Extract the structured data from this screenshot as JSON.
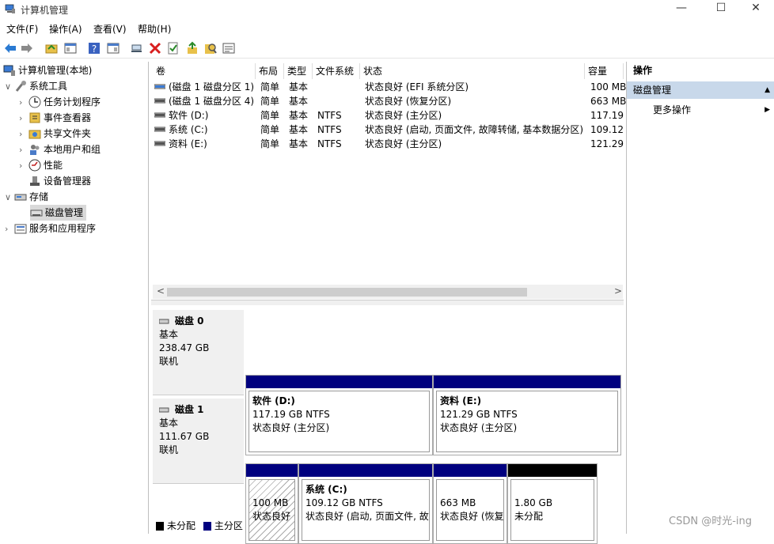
{
  "window": {
    "title": "计算机管理",
    "minimize": "—",
    "maximize": "☐",
    "close": "✕"
  },
  "menu": [
    "文件(F)",
    "操作(A)",
    "查看(V)",
    "帮助(H)"
  ],
  "toolbar_icons": [
    "back-icon",
    "forward-icon",
    "up-folder-icon",
    "show-hide-tree-icon",
    "help-icon",
    "console-icon",
    "connect-icon",
    "delete-icon",
    "properties-icon",
    "import-icon",
    "search-icon",
    "list-icon"
  ],
  "tree": {
    "root": "计算机管理(本地)",
    "system_tools": "系统工具",
    "items": [
      "任务计划程序",
      "事件查看器",
      "共享文件夹",
      "本地用户和组",
      "性能",
      "设备管理器"
    ],
    "storage": "存储",
    "disk_management": "磁盘管理",
    "services": "服务和应用程序"
  },
  "volume_table": {
    "headers": [
      "卷",
      "布局",
      "类型",
      "文件系统",
      "状态",
      "容量"
    ],
    "rows": [
      [
        "(磁盘 1 磁盘分区 1)",
        "简单",
        "基本",
        "",
        "状态良好 (EFI 系统分区)",
        "100 MB"
      ],
      [
        "(磁盘 1 磁盘分区 4)",
        "简单",
        "基本",
        "",
        "状态良好 (恢复分区)",
        "663 MB"
      ],
      [
        "软件 (D:)",
        "简单",
        "基本",
        "NTFS",
        "状态良好 (主分区)",
        "117.19"
      ],
      [
        "系统 (C:)",
        "简单",
        "基本",
        "NTFS",
        "状态良好 (启动, 页面文件, 故障转储, 基本数据分区)",
        "109.12"
      ],
      [
        "资料 (E:)",
        "简单",
        "基本",
        "NTFS",
        "状态良好 (主分区)",
        "121.29"
      ]
    ],
    "scroll_left": "<",
    "scroll_right": ">"
  },
  "disks": [
    {
      "name": "磁盘 0",
      "type": "基本",
      "size": "238.47 GB",
      "state": "联机",
      "partitions": [
        {
          "name": "软件  (D:)",
          "size": "117.19 GB NTFS",
          "status": "状态良好 (主分区)"
        },
        {
          "name": "资料  (E:)",
          "size": "121.29 GB NTFS",
          "status": "状态良好 (主分区)"
        }
      ]
    },
    {
      "name": "磁盘 1",
      "type": "基本",
      "size": "111.67 GB",
      "state": "联机",
      "partitions": [
        {
          "name": "",
          "size": "100 MB",
          "status": "状态良好"
        },
        {
          "name": "系统  (C:)",
          "size": "109.12 GB NTFS",
          "status": "状态良好 (启动, 页面文件, 故"
        },
        {
          "name": "",
          "size": "663 MB",
          "status": "状态良好 (恢复"
        },
        {
          "name": "",
          "size": "1.80 GB",
          "status": "未分配"
        }
      ]
    }
  ],
  "legend": {
    "unallocated": "未分配",
    "primary": "主分区"
  },
  "colors": {
    "primary_partition": "#00007f",
    "unallocated": "#000000",
    "selection": "#c8d8ea"
  },
  "actions": {
    "title": "操作",
    "section": "磁盘管理",
    "more": "更多操作"
  },
  "watermark": "CSDN @时光-ing"
}
